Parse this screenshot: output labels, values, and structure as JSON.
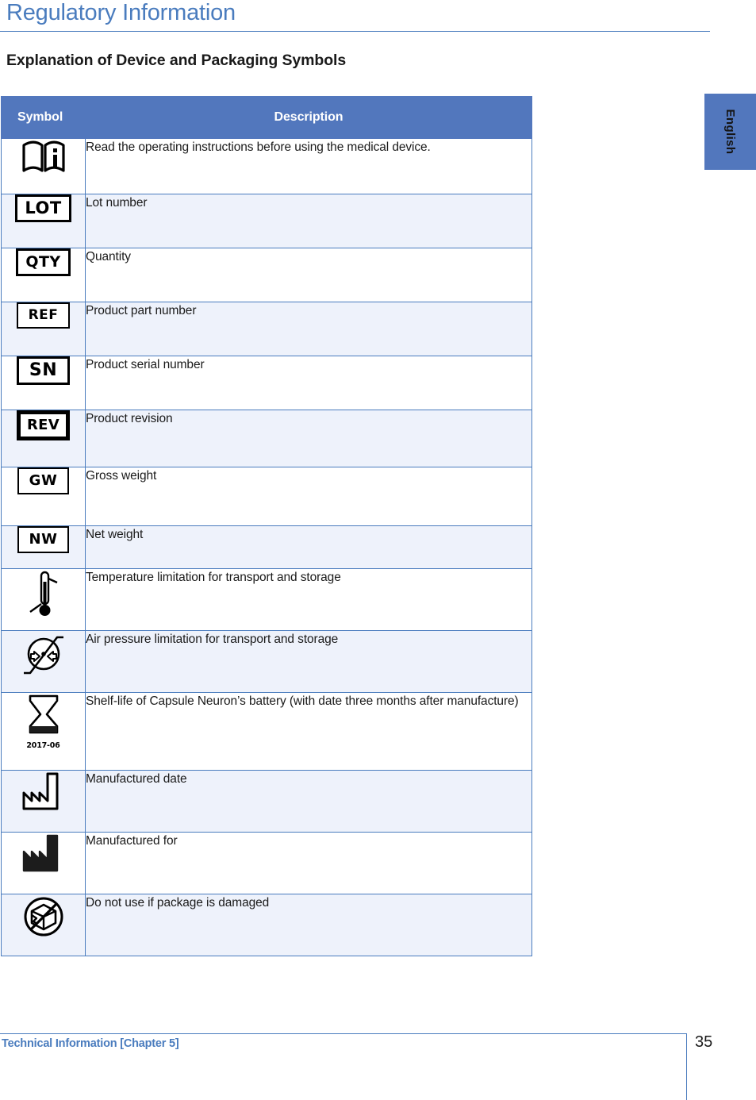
{
  "header": {
    "title": "Regulatory Information"
  },
  "section": {
    "heading": "Explanation of Device and Packaging Symbols"
  },
  "language_tab": {
    "label": "English"
  },
  "table": {
    "columns": {
      "symbol": "Symbol",
      "description": "Description"
    },
    "rows": [
      {
        "icon": "instructions-for-use-icon",
        "symbol_text": "",
        "description": "Read the operating instructions before using the medical device."
      },
      {
        "icon": "lot-number-icon",
        "symbol_text": "LOT",
        "description": "Lot number"
      },
      {
        "icon": "quantity-icon",
        "symbol_text": "QTY",
        "description": "Quantity"
      },
      {
        "icon": "catalogue-number-icon",
        "symbol_text": "REF",
        "description": "Product part number"
      },
      {
        "icon": "serial-number-icon",
        "symbol_text": "SN",
        "description": "Product serial number"
      },
      {
        "icon": "revision-icon",
        "symbol_text": "REV",
        "description": "Product revision"
      },
      {
        "icon": "gross-weight-icon",
        "symbol_text": "GW",
        "description": "Gross weight"
      },
      {
        "icon": "net-weight-icon",
        "symbol_text": "NW",
        "description": "Net weight"
      },
      {
        "icon": "temperature-limit-icon",
        "symbol_text": "",
        "description": "Temperature limitation for transport and storage"
      },
      {
        "icon": "air-pressure-limit-icon",
        "symbol_text": "",
        "description": "Air pressure limitation for transport and storage"
      },
      {
        "icon": "use-by-hourglass-icon",
        "symbol_text": "2017-06",
        "description": "Shelf-life of Capsule Neuron’s battery (with date three months after manufacture)"
      },
      {
        "icon": "date-of-manufacture-icon",
        "symbol_text": "",
        "description": "Manufactured date"
      },
      {
        "icon": "manufacturer-icon",
        "symbol_text": "",
        "description": "Manufactured for"
      },
      {
        "icon": "do-not-use-if-damaged-icon",
        "symbol_text": "",
        "description": "Do not use if package is damaged"
      }
    ]
  },
  "footer": {
    "text": "Technical Information [Chapter 5]",
    "page_number": "35"
  },
  "colors": {
    "accent_blue": "#5277bd",
    "title_blue": "#4a7cbe",
    "row_alt": "#eef2fb"
  }
}
